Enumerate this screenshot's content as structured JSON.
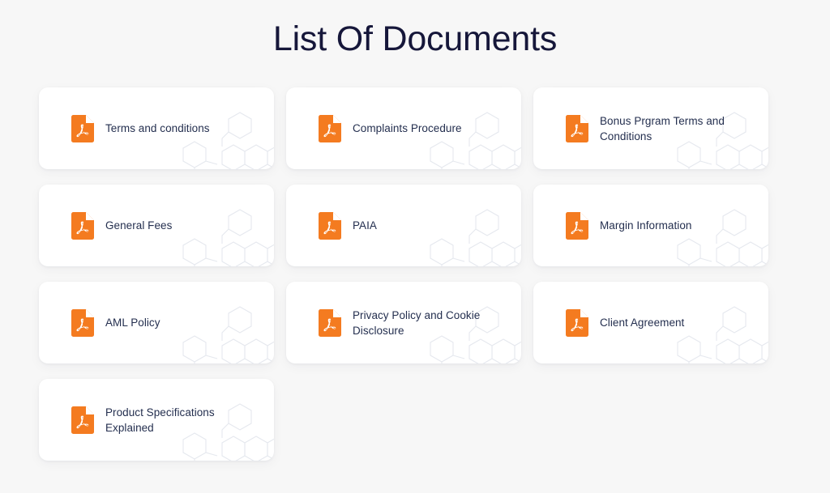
{
  "page": {
    "title": "List Of Documents",
    "background_color": "#f7f7f7",
    "card_color": "#ffffff",
    "title_color": "#16173a",
    "label_color": "#242f4f",
    "accent_color": "#f47b20",
    "watermark_color": "#dfe2ea"
  },
  "documents": [
    {
      "label": "Terms and conditions",
      "icon": "pdf-file-icon"
    },
    {
      "label": "Complaints Procedure",
      "icon": "pdf-file-icon"
    },
    {
      "label": "Bonus Prgram Terms and Conditions",
      "icon": "pdf-file-icon"
    },
    {
      "label": "General Fees",
      "icon": "pdf-file-icon"
    },
    {
      "label": "PAIA",
      "icon": "pdf-file-icon"
    },
    {
      "label": "Margin Information",
      "icon": "pdf-file-icon"
    },
    {
      "label": "AML Policy",
      "icon": "pdf-file-icon"
    },
    {
      "label": "Privacy Policy and Cookie Disclosure",
      "icon": "pdf-file-icon"
    },
    {
      "label": "Client Agreement",
      "icon": "pdf-file-icon"
    },
    {
      "label": "Product Specifications Explained",
      "icon": "pdf-file-icon"
    }
  ]
}
